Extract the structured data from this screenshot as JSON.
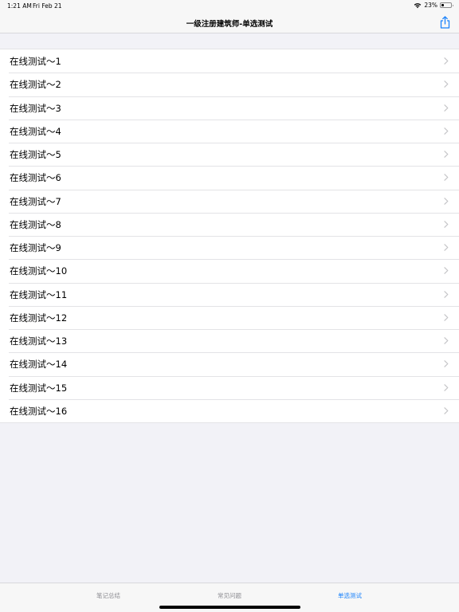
{
  "status_bar": {
    "time": "1:21 AM",
    "date": "Fri Feb 21",
    "battery_text": "23%",
    "battery_level": 0.23,
    "icons": [
      "wifi-icon",
      "battery-icon"
    ]
  },
  "nav": {
    "title": "一级注册建筑师-单选测试",
    "share_icon": "share-icon",
    "accent_color": "#1a82fb"
  },
  "list": {
    "items": [
      {
        "label": "在线测试～1"
      },
      {
        "label": "在线测试～2"
      },
      {
        "label": "在线测试～3"
      },
      {
        "label": "在线测试～4"
      },
      {
        "label": "在线测试～5"
      },
      {
        "label": "在线测试～6"
      },
      {
        "label": "在线测试～7"
      },
      {
        "label": "在线测试～8"
      },
      {
        "label": "在线测试～9"
      },
      {
        "label": "在线测试～10"
      },
      {
        "label": "在线测试～11"
      },
      {
        "label": "在线测试～12"
      },
      {
        "label": "在线测试～13"
      },
      {
        "label": "在线测试～14"
      },
      {
        "label": "在线测试～15"
      },
      {
        "label": "在线测试～16"
      }
    ],
    "chevron_icon": "chevron-right-icon"
  },
  "tab_bar": {
    "tabs": [
      {
        "label": "笔记总结",
        "active": false
      },
      {
        "label": "常见问题",
        "active": false
      },
      {
        "label": "单选测试",
        "active": true
      }
    ]
  }
}
